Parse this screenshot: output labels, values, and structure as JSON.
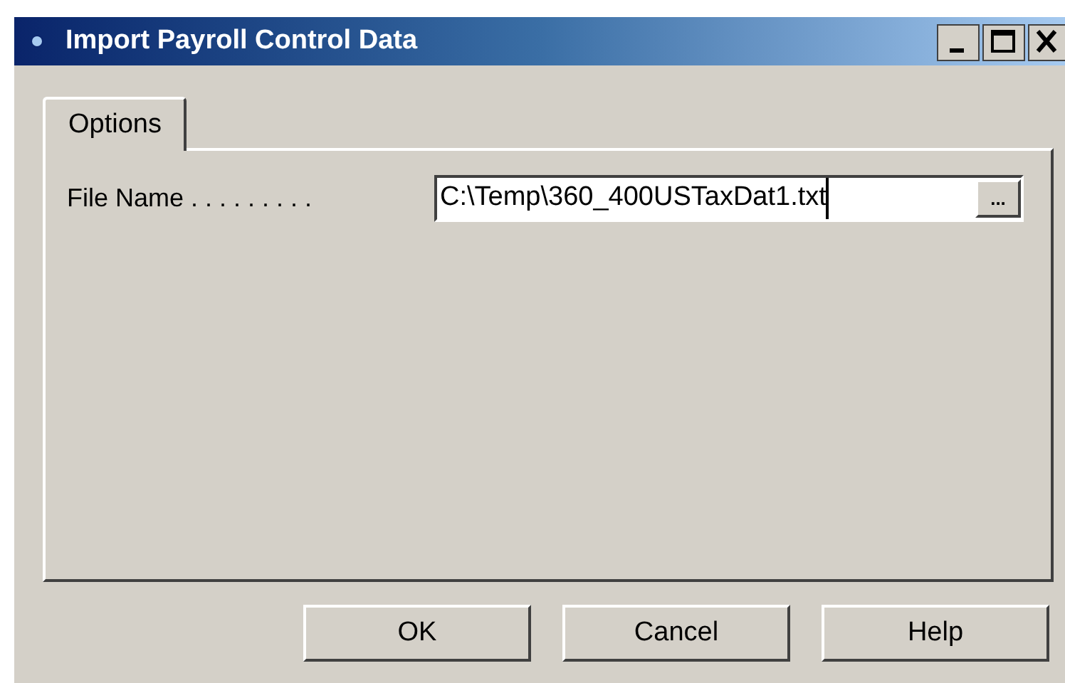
{
  "window": {
    "title": "Import Payroll Control Data"
  },
  "tabs": [
    {
      "label": "Options",
      "selected": true
    }
  ],
  "fields": [
    {
      "label": "File Name . . . . . . . . .",
      "value": "C:\\Temp\\360_400USTaxDat1.txt",
      "browse": "..."
    }
  ],
  "buttons": [
    "OK",
    "Cancel",
    "Help"
  ]
}
